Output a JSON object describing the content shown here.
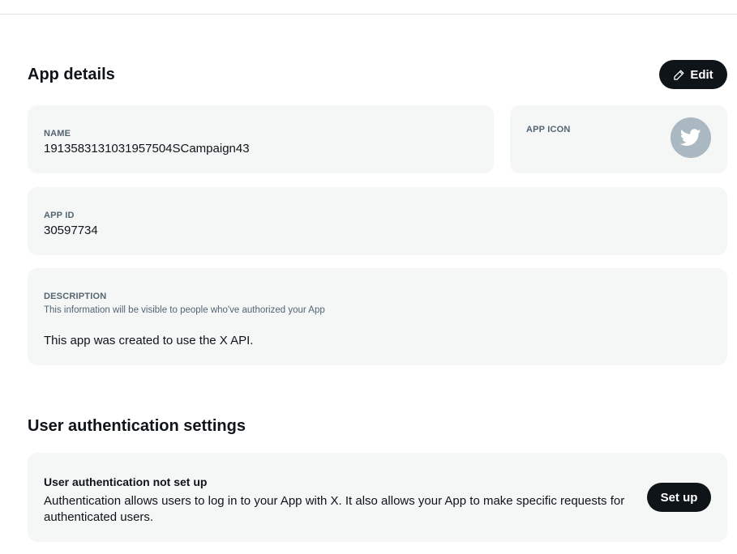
{
  "app_details": {
    "title": "App details",
    "edit_label": "Edit",
    "name_label": "NAME",
    "name_value": "1913583131031957504SCampaign43",
    "app_icon_label": "APP ICON",
    "app_icon_name": "twitter-bird-icon",
    "app_id_label": "APP ID",
    "app_id_value": "30597734",
    "description_label": "DESCRIPTION",
    "description_hint": "This information will be visible to people who've authorized your App",
    "description_value": "This app was created to use the X API."
  },
  "user_auth": {
    "title": "User authentication settings",
    "status_title": "User authentication not set up",
    "status_text": "Authentication allows users to log in to your App with X. It also allows your App to make specific requests for authenticated users.",
    "setup_label": "Set up"
  },
  "colors": {
    "card_bg": "#f5f7f7",
    "button_bg": "#0f1419",
    "icon_bg": "#aab8c2",
    "label_gray": "#536471"
  }
}
